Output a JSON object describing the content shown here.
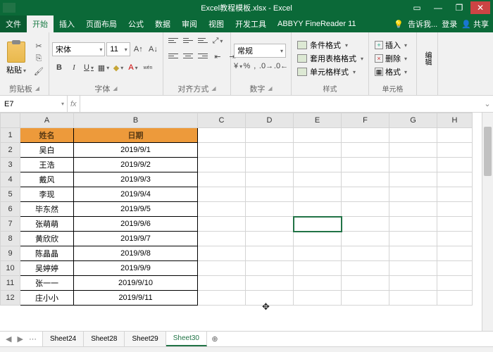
{
  "window": {
    "title": "Excel教程模板.xlsx - Excel"
  },
  "menu": {
    "file": "文件",
    "home": "开始",
    "insert": "插入",
    "layout": "页面布局",
    "formula": "公式",
    "data": "数据",
    "review": "审阅",
    "view": "视图",
    "dev": "开发工具",
    "abbyy": "ABBYY FineReader 11",
    "tellme": "告诉我...",
    "login": "登录",
    "share": "共享"
  },
  "ribbon": {
    "paste": "粘贴",
    "clipboard": "剪贴板",
    "font": {
      "name": "宋体",
      "size": "11",
      "group": "字体"
    },
    "align": "对齐方式",
    "number": {
      "format": "常规",
      "group": "数字"
    },
    "styles": {
      "cond": "条件格式",
      "table": "套用表格格式",
      "cell": "单元格样式",
      "group": "样式"
    },
    "cells": {
      "insert": "插入",
      "delete": "删除",
      "format": "格式",
      "group": "单元格"
    },
    "editing": "编辑"
  },
  "namebox": "E7",
  "fx": "fx",
  "cols": [
    "A",
    "B",
    "C",
    "D",
    "E",
    "F",
    "G",
    "H"
  ],
  "rows": [
    "1",
    "2",
    "3",
    "4",
    "5",
    "6",
    "7",
    "8",
    "9",
    "10",
    "11",
    "12"
  ],
  "header": {
    "name": "姓名",
    "date": "日期"
  },
  "data_rows": [
    {
      "name": "吴白",
      "date": "2019/9/1"
    },
    {
      "name": "王浩",
      "date": "2019/9/2"
    },
    {
      "name": "戴风",
      "date": "2019/9/3"
    },
    {
      "name": "李现",
      "date": "2019/9/4"
    },
    {
      "name": "毕东然",
      "date": "2019/9/5"
    },
    {
      "name": "张萌萌",
      "date": "2019/9/6"
    },
    {
      "name": "黄欣欣",
      "date": "2019/9/7"
    },
    {
      "name": "陈晶晶",
      "date": "2019/9/8"
    },
    {
      "name": "吴婷婷",
      "date": "2019/9/9"
    },
    {
      "name": "张一一",
      "date": "2019/9/10"
    },
    {
      "name": "庄小小",
      "date": "2019/9/11"
    }
  ],
  "sheets": [
    "Sheet24",
    "Sheet28",
    "Sheet29",
    "Sheet30"
  ],
  "active_sheet": "Sheet30",
  "selected_cell": "E7"
}
